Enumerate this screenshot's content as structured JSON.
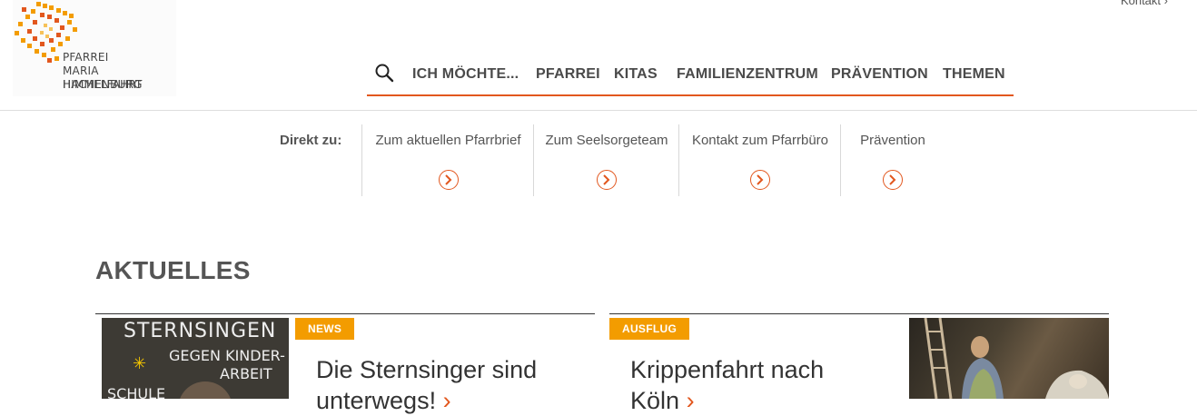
{
  "brand": {
    "logo_lines": [
      "PFARREI",
      "MARIA HIMMELFAHRT",
      "HACHENBURG"
    ],
    "accent_color": "#e2571e",
    "badge_color": "#f39c00"
  },
  "header": {
    "contact_label": "Kontakt",
    "search_icon": "search-icon",
    "nav": [
      "ICH MÖCHTE...",
      "PFARREI",
      "KITAS",
      "FAMILIENZENTRUM",
      "PRÄVENTION",
      "THEMEN"
    ]
  },
  "direkt": {
    "label": "Direkt zu:",
    "links": [
      "Zum aktuellen Pfarrbrief",
      "Zum Seelsorgeteam",
      "Kontakt zum Pfarrbüro",
      "Prävention"
    ]
  },
  "news": {
    "heading": "AKTUELLES",
    "cards": [
      {
        "badge": "NEWS",
        "title_line1": "Die Sternsinger sind",
        "title_line2": "unterwegs!",
        "image_text": [
          "STERNSINGEN",
          "GEGEN KINDER-",
          "ARBEIT",
          "SCHULE"
        ]
      },
      {
        "badge": "AUSFLUG",
        "title_line1": "Krippenfahrt nach",
        "title_line2": "Köln"
      }
    ]
  }
}
